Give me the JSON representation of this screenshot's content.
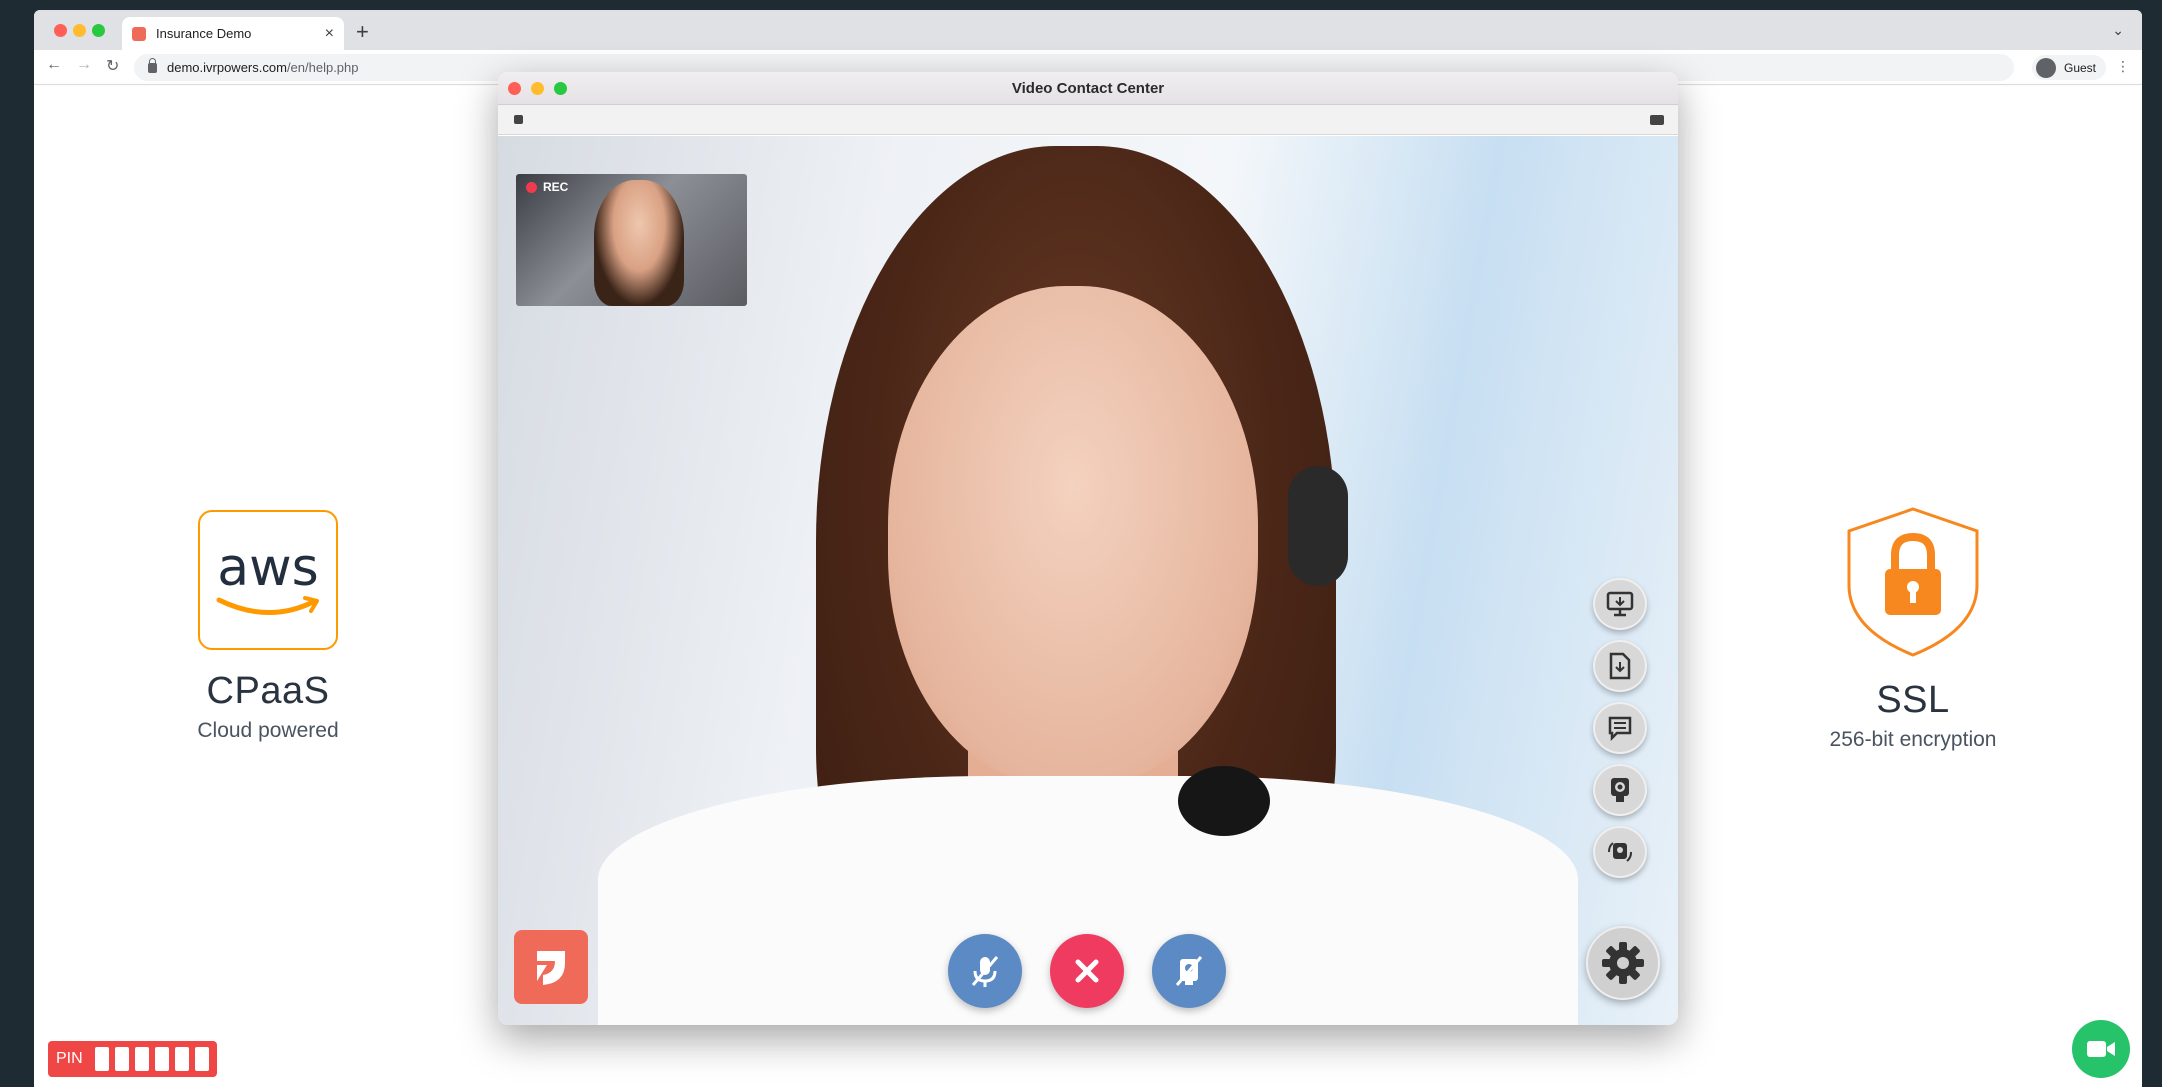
{
  "browser": {
    "tab_title": "Insurance Demo",
    "tab_close": "×",
    "new_tab": "+",
    "url_host": "demo.ivrpowers.com",
    "url_path": "/en/help.php",
    "profile_label": "Guest",
    "nav_back": "←",
    "nav_forward": "→",
    "nav_reload": "↻",
    "menu": "⋮",
    "tabstrip_menu": "⌄"
  },
  "features": {
    "left": {
      "logo_text": "aws",
      "title": "CPaaS",
      "subtitle": "Cloud powered",
      "logo_color": "#ff9900"
    },
    "right": {
      "title": "SSL",
      "subtitle": "256-bit encryption",
      "logo_color": "#f7881f"
    }
  },
  "pin": {
    "label": "PIN",
    "digits": [
      "",
      "",
      "",
      "",
      "",
      ""
    ]
  },
  "video_window": {
    "title": "Video Contact Center",
    "rec_label": "REC"
  },
  "colors": {
    "accent_red": "#f03b60",
    "control_blue": "#5b8ac4",
    "brand_coral": "#f06a5a",
    "fab_green": "#27c36b"
  },
  "icons": {
    "side_tools": [
      "screen-share-icon",
      "file-download-icon",
      "chat-icon",
      "webcam-icon",
      "camera-switch-icon"
    ],
    "settings": "gear-icon"
  }
}
